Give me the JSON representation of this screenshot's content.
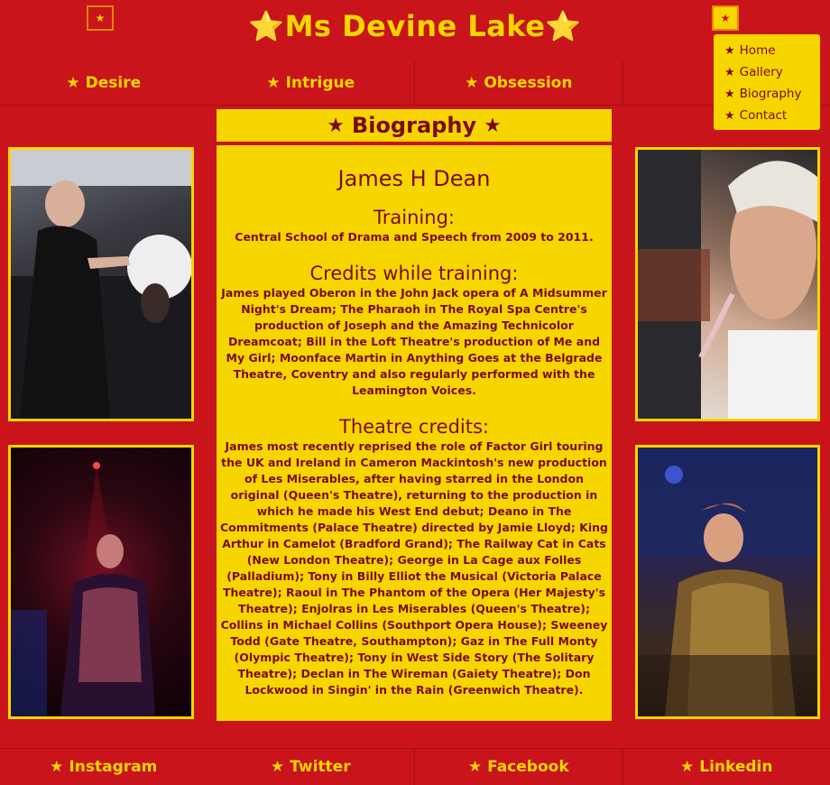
{
  "header": {
    "title": "⭐Ms Devine Lake⭐",
    "left_button_icon": "star-icon",
    "right_button_icon": "star-icon"
  },
  "dropdown": {
    "items": [
      {
        "label": "Home",
        "icon": "star-icon"
      },
      {
        "label": "Gallery",
        "icon": "star-icon"
      },
      {
        "label": "Biography",
        "icon": "star-icon"
      },
      {
        "label": "Contact",
        "icon": "star-icon"
      }
    ]
  },
  "top_nav": [
    {
      "label": "Desire",
      "icon": "star-icon"
    },
    {
      "label": "Intrigue",
      "icon": "star-icon"
    },
    {
      "label": "Obsession",
      "icon": "star-icon"
    },
    {
      "label": "",
      "icon": "star-icon"
    }
  ],
  "bio": {
    "header": "Biography",
    "name": "James H Dean",
    "training_heading": "Training:",
    "training_text": "Central School of Drama and Speech from 2009 to 2011.",
    "credits_heading": "Credits while training:",
    "credits_text": "James played Oberon in the John Jack opera of A Midsummer Night's Dream; The Pharaoh in The Royal Spa Centre's production of Joseph and the Amazing Technicolor Dreamcoat; Bill in the Loft Theatre's production of Me and My Girl; Moonface Martin in Anything Goes at the Belgrade Theatre, Coventry and also regularly performed with the Leamington Voices.",
    "theatre_heading": "Theatre credits:",
    "theatre_text": "James most recently reprised the role of Factor Girl touring the UK and Ireland in Cameron Mackintosh's new production of Les Miserables, after having starred in the London original (Queen's Theatre), returning to the production in which he made his West End debut; Deano in The Commitments (Palace Theatre) directed by Jamie Lloyd; King Arthur in Camelot (Bradford Grand); The Railway Cat in Cats (New London Theatre); George in La Cage aux Folles (Palladium); Tony in Billy Elliot the Musical (Victoria Palace Theatre); Raoul in The Phantom of the Opera (Her Majesty's Theatre); Enjolras in Les Miserables (Queen's Theatre); Collins in Michael Collins (Southport Opera House); Sweeney Todd (Gate Theatre, Southampton); Gaz in The Full Monty (Olympic Theatre); Tony in West Side Story (The Solitary Theatre); Declan in The Wireman (Gaiety Theatre); Don Lockwood in Singin' in the Rain (Greenwich Theatre)."
  },
  "bottom_nav": [
    {
      "label": "Instagram",
      "icon": "star-icon"
    },
    {
      "label": "Twitter",
      "icon": "star-icon"
    },
    {
      "label": "Facebook",
      "icon": "star-icon"
    },
    {
      "label": "Linkedin",
      "icon": "star-icon"
    }
  ],
  "photos": [
    {
      "subject": "performer-dressing-room-photo"
    },
    {
      "subject": "performer-makeup-profile-photo"
    },
    {
      "subject": "performer-stage-spotlight-photo"
    },
    {
      "subject": "performer-bar-sequin-photo"
    }
  ],
  "colors": {
    "background": "#c8141a",
    "accent": "#f7d600",
    "text_dark": "#7a0a10"
  }
}
